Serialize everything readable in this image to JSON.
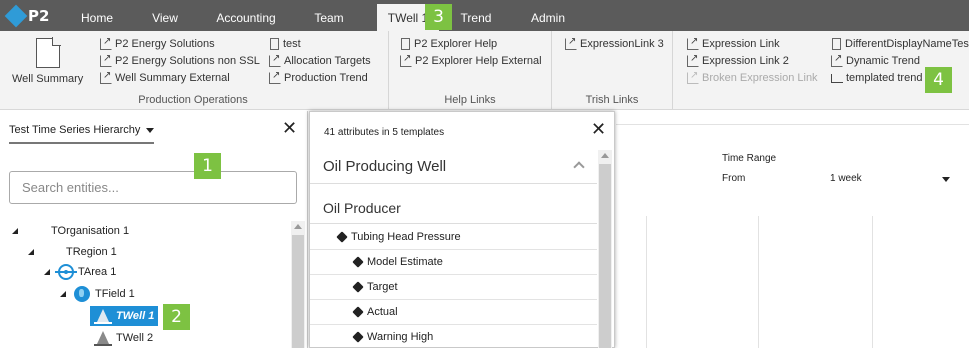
{
  "app": {
    "logo_text": "P2",
    "brand_color": "#2f9bd7",
    "badge_color": "#7dc242"
  },
  "nav_tabs": [
    {
      "label": "Home"
    },
    {
      "label": "View"
    },
    {
      "label": "Accounting"
    },
    {
      "label": "Team"
    },
    {
      "label": "TWell 1",
      "active": true
    },
    {
      "label": "Trend"
    },
    {
      "label": "Admin"
    }
  ],
  "ribbon": {
    "well_summary_label": "Well Summary",
    "production_operations": {
      "label": "Production Operations",
      "links_col1": [
        "P2 Energy Solutions",
        "P2 Energy Solutions non SSL",
        "Well Summary External"
      ],
      "links_col2": [
        "test",
        "Allocation Targets",
        "Production Trend"
      ]
    },
    "help_links": {
      "label": "Help Links",
      "links": [
        "P2 Explorer Help",
        "P2 Explorer Help External"
      ]
    },
    "trish_links": {
      "label": "Trish Links",
      "links": [
        "ExpressionLink 3"
      ]
    },
    "misc": {
      "links_col1": [
        "Expression Link",
        "Expression Link 2",
        "Broken Expression Link"
      ],
      "links_col2": [
        "DifferentDisplayNameTest",
        "Dynamic Trend",
        "templated trend"
      ]
    }
  },
  "badges": [
    "1",
    "2",
    "3",
    "4"
  ],
  "left_panel": {
    "hierarchy_label": "Test Time Series Hierarchy",
    "search_placeholder": "Search entities...",
    "tree": [
      {
        "label": "TOrganisation 1",
        "icon": "none",
        "expanded": true
      },
      {
        "label": "TRegion 1",
        "icon": "none",
        "expanded": true
      },
      {
        "label": "TArea 1",
        "icon": "target-icon",
        "expanded": true
      },
      {
        "label": "TField 1",
        "icon": "globe-icon",
        "expanded": true
      },
      {
        "label": "TWell 1",
        "icon": "well-icon",
        "selected": true
      },
      {
        "label": "TWell 2",
        "icon": "well-icon"
      }
    ]
  },
  "attributes_popup": {
    "count_text": "41 attributes in 5 templates",
    "template_title": "Oil Producing Well",
    "sub_template": "Oil Producer",
    "attributes": [
      {
        "label": "Tubing Head Pressure",
        "level": 1
      },
      {
        "label": "Model Estimate",
        "level": 2
      },
      {
        "label": "Target",
        "level": 2
      },
      {
        "label": "Actual",
        "level": 2
      },
      {
        "label": "Warning High",
        "level": 2
      }
    ]
  },
  "right_area": {
    "time_range_label": "Time Range",
    "from_label": "From",
    "from_value": "1 week"
  }
}
